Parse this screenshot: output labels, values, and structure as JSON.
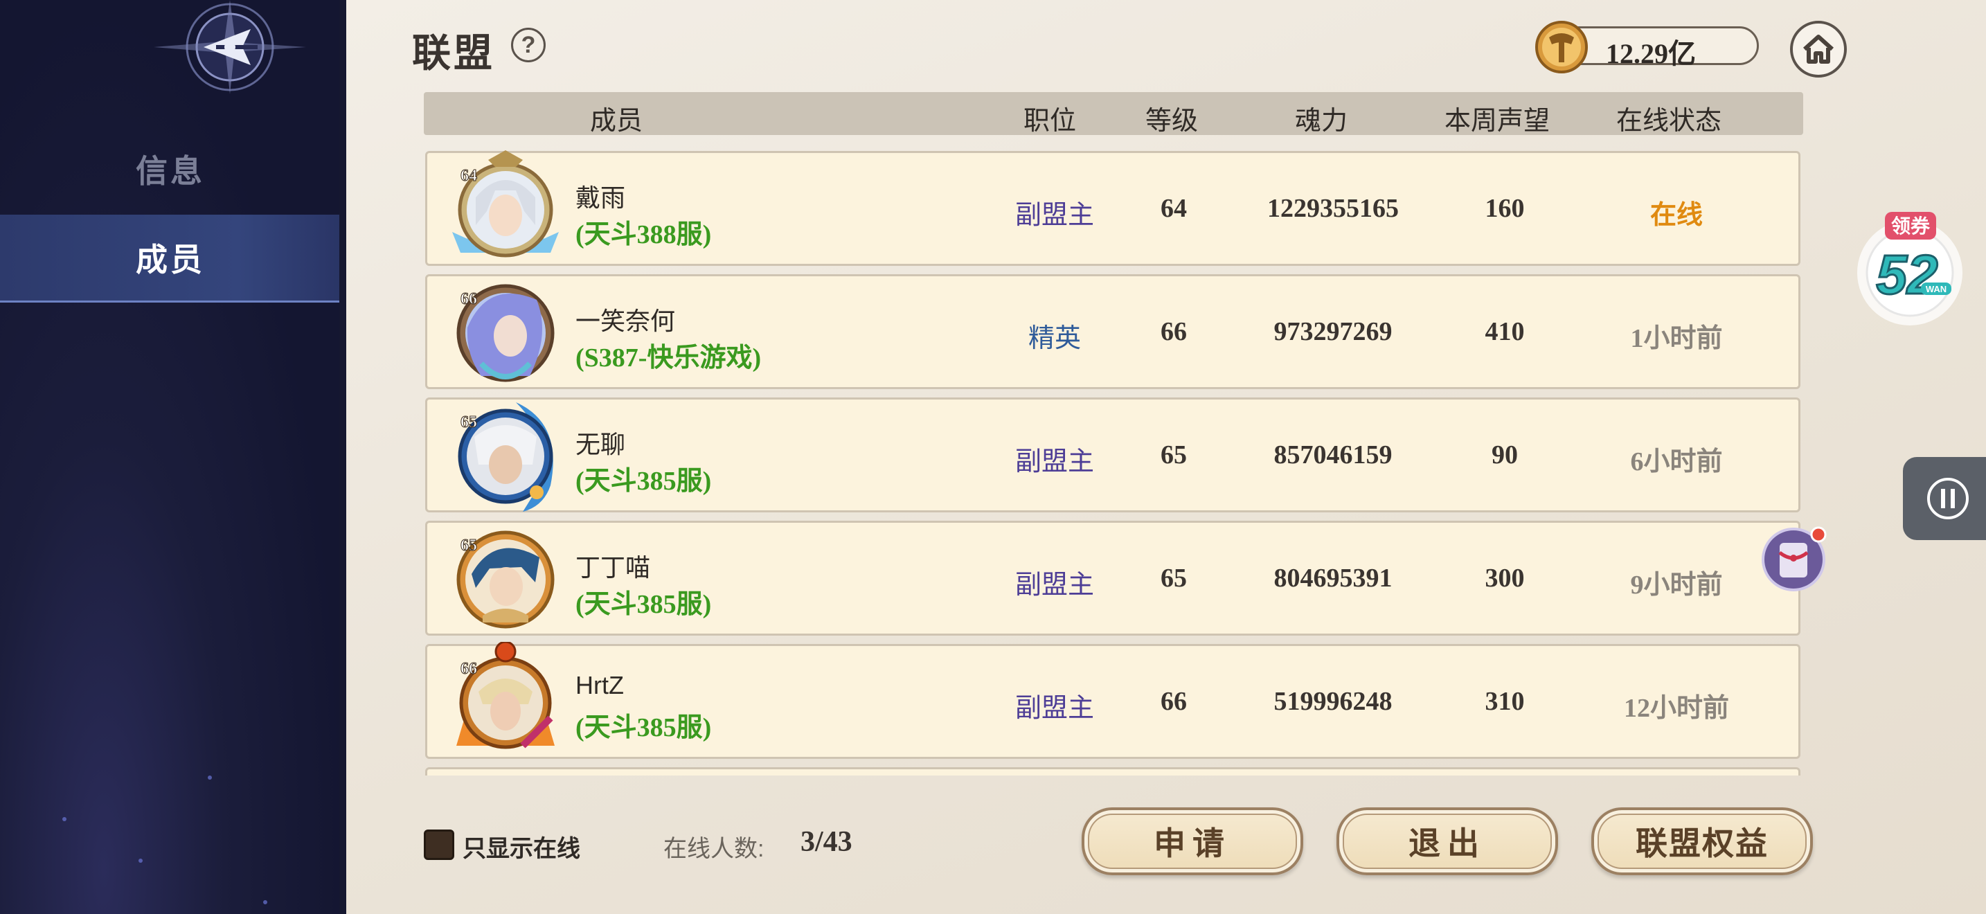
{
  "sidebar": {
    "items": [
      {
        "label": "信息",
        "active": false
      },
      {
        "label": "成员",
        "active": true
      }
    ]
  },
  "header": {
    "title": "联盟",
    "help_icon": "?",
    "currency_value": "12.29亿"
  },
  "table": {
    "columns": [
      "成员",
      "职位",
      "等级",
      "魂力",
      "本周声望",
      "在线状态"
    ],
    "rows": [
      {
        "level_badge": "64",
        "name": "戴雨",
        "server": "(天斗388服)",
        "role": "副盟主",
        "level": "64",
        "power": "1229355165",
        "prestige": "160",
        "status": "在线"
      },
      {
        "level_badge": "66",
        "name": "一笑奈何",
        "server": "(S387-快乐游戏)",
        "role": "精英",
        "level": "66",
        "power": "973297269",
        "prestige": "410",
        "status": "1小时前"
      },
      {
        "level_badge": "65",
        "name": "无聊",
        "server": "(天斗385服)",
        "role": "副盟主",
        "level": "65",
        "power": "857046159",
        "prestige": "90",
        "status": "6小时前"
      },
      {
        "level_badge": "65",
        "name": "丁丁喵",
        "server": "(天斗385服)",
        "role": "副盟主",
        "level": "65",
        "power": "804695391",
        "prestige": "300",
        "status": "9小时前"
      },
      {
        "level_badge": "66",
        "name": "HrtZ",
        "server": "(天斗385服)",
        "role": "副盟主",
        "level": "66",
        "power": "519996248",
        "prestige": "310",
        "status": "12小时前"
      }
    ]
  },
  "footer": {
    "only_online_label": "只显示在线",
    "online_count_label": "在线人数:",
    "online_count": "3/43",
    "buttons": {
      "apply": "申请",
      "quit": "退出",
      "benefits": "联盟权益"
    }
  },
  "widgets": {
    "coupon_label": "领券",
    "coupon_number": "52",
    "coupon_unit": "WAN"
  },
  "colors": {
    "sidebar_bg": "#161830",
    "row_bg": "#fcf3dd",
    "server_green": "#3a9a1f",
    "role_purple": "#4d3d96",
    "status_online": "#e08a10"
  }
}
